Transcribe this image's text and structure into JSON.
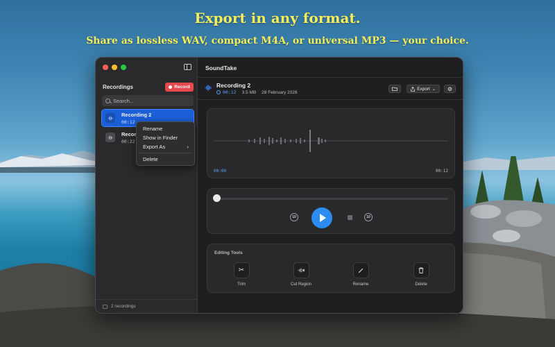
{
  "promo": {
    "headline": "Export in any format.",
    "subline": "Share as lossless WAV, compact M4A, or universal MP3 — your choice."
  },
  "app": {
    "title": "SoundTake"
  },
  "sidebar": {
    "section_title": "Recordings",
    "record_label": "Record",
    "search_placeholder": "Search...",
    "items": [
      {
        "name": "Recording 2",
        "duration": "00:12",
        "selected": true
      },
      {
        "name": "Record",
        "duration": "00:22",
        "selected": false
      }
    ],
    "footer": "2 recordings"
  },
  "context_menu": {
    "items": [
      "Rename",
      "Show in Finder",
      "Export As",
      "Delete"
    ],
    "submenu_arrow": "›"
  },
  "detail": {
    "title": "Recording 2",
    "duration": "00:12",
    "size": "3.5 MB",
    "date": "28 February 2026",
    "export_label": "Export"
  },
  "waveform": {
    "start_time": "00:00",
    "end_time": "00:12"
  },
  "player": {
    "progress": 0.0,
    "skip_back_label": "10",
    "skip_forward_label": "10"
  },
  "tools": {
    "title": "Editing Tools",
    "items": [
      {
        "label": "Trim",
        "icon": "scissors-icon"
      },
      {
        "label": "Cut Region",
        "icon": "cut-region-icon"
      },
      {
        "label": "Rename",
        "icon": "pencil-icon"
      },
      {
        "label": "Delete",
        "icon": "trash-icon"
      }
    ]
  },
  "colors": {
    "accent": "#2d8cf0",
    "record": "#e5484d",
    "headline": "#f5ee5a",
    "time_blue": "#5ea2ff"
  }
}
